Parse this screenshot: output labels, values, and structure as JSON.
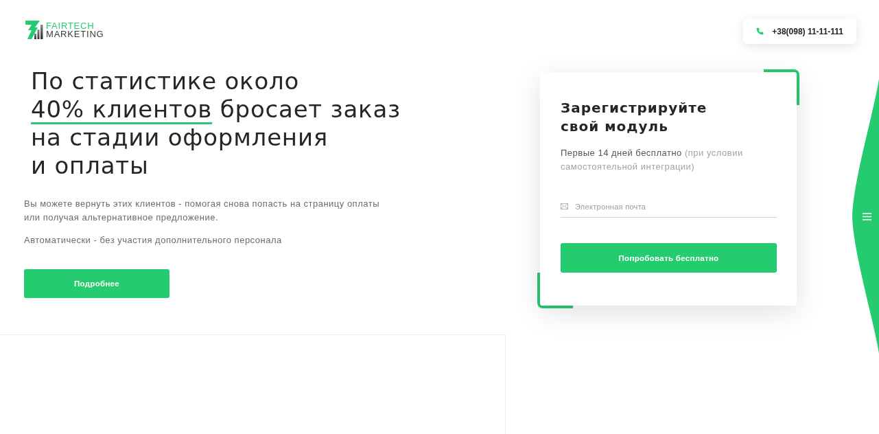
{
  "header": {
    "logo": {
      "line_1": "FAIRTECH",
      "line_2": "MARKETING"
    },
    "phone": "+38(098) 11-11-111"
  },
  "hero": {
    "headline": {
      "text_before": "По статистике около\n",
      "highlight": "40% клиентов",
      "text_after": " бросает заказ\nна стадии оформления\nи оплаты"
    },
    "paragraphs": [
      "Вы можете вернуть этих клиентов - помогая снова попасть на страницу оплаты или получая альтернативное предложение.",
      "Автоматически - без участия дополнительного персонала"
    ],
    "button": "Подробнее"
  },
  "signup_card": {
    "title": "Зарегистрируйте\nсвой модуль",
    "description": {
      "text": "Первые 14 дней бесплатно",
      "note": "(при условии самостоятельной интеграции)"
    },
    "email_field": {
      "placeholder": "Электронная почта"
    },
    "button": "Попробовать бесплатно"
  }
}
